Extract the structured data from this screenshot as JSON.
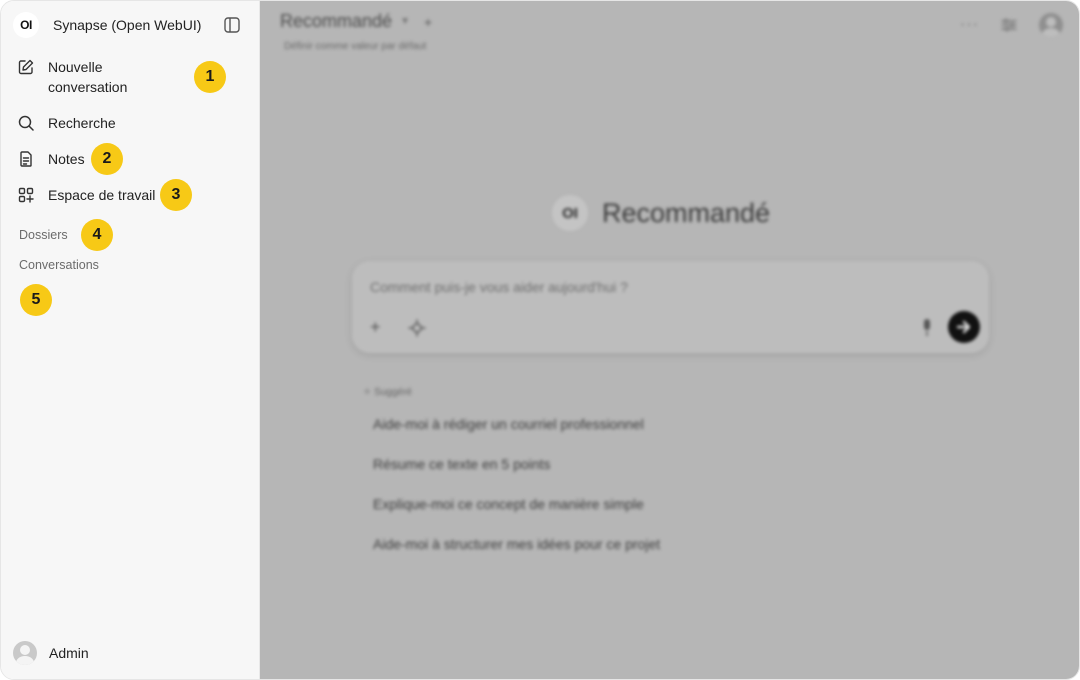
{
  "app": {
    "logo_text": "OI",
    "name": "Synapse (Open WebUI)"
  },
  "nav": {
    "new_chat": "Nouvelle conversation",
    "search": "Recherche",
    "notes": "Notes",
    "workspace": "Espace de travail"
  },
  "sections": {
    "folders": "Dossiers",
    "conversations": "Conversations"
  },
  "badges": [
    "1",
    "2",
    "3",
    "4",
    "5"
  ],
  "user": {
    "name": "Admin"
  },
  "main": {
    "model_title": "Recommandé",
    "set_default": "Définir comme valeur par défaut",
    "hero_logo": "OI",
    "hero_title": "Recommandé",
    "input_placeholder": "Comment puis-je vous aider aujourd'hui ?",
    "suggested_label": "Suggéré",
    "suggestions": [
      "Aide-moi à rédiger un courriel professionnel",
      "Résume ce texte en 5 points",
      "Explique-moi ce concept de manière simple",
      "Aide-moi à structurer mes idées pour ce projet"
    ]
  },
  "colors": {
    "badge": "#f7c916",
    "overlay": "#b6b6b6",
    "sidebar": "#f7f7f7"
  }
}
